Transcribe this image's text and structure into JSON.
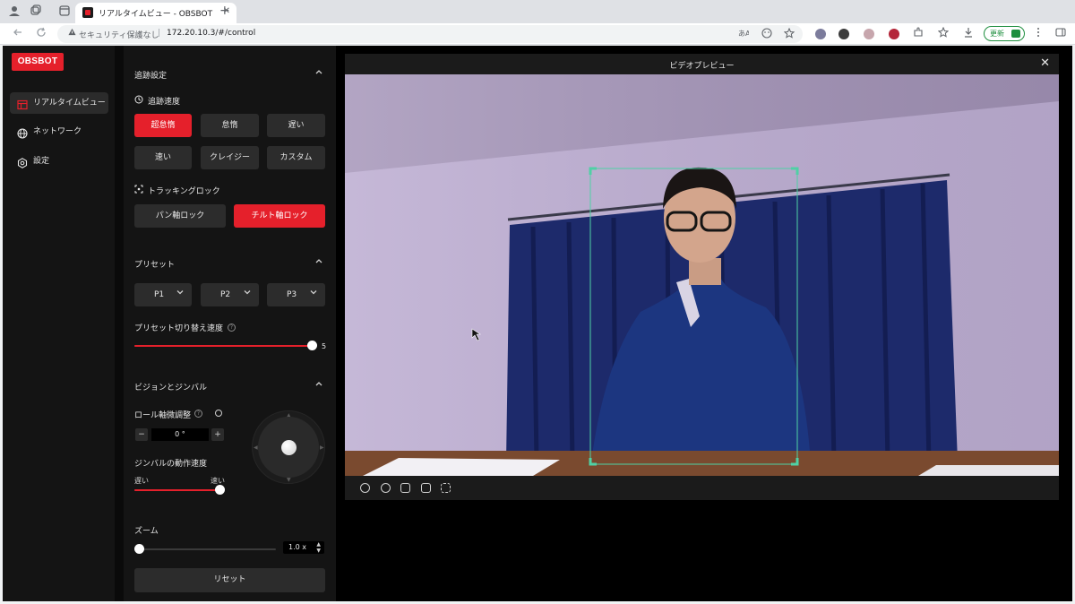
{
  "browser": {
    "tab_title": "リアルタイムビュー - OBSBOT",
    "tab_close": "✕",
    "new_tab": "+",
    "security_text": "セキュリティ保護なし",
    "separator": "|",
    "url": "172.20.10.3/#/control",
    "update_label": "更新"
  },
  "app": {
    "logo": "OBSBOT",
    "nav": [
      {
        "label": "リアルタイムビュー",
        "icon": "layout-icon",
        "active": true
      },
      {
        "label": "ネットワーク",
        "icon": "globe-icon",
        "active": false
      },
      {
        "label": "設定",
        "icon": "gear-icon",
        "active": false
      }
    ]
  },
  "tracking": {
    "title": "追跡設定",
    "speed_label": "追跡速度",
    "speeds": [
      "超怠惰",
      "怠惰",
      "遅い",
      "速い",
      "クレイジー",
      "カスタム"
    ],
    "selected_speed": "超怠惰",
    "lock_label": "トラッキングロック",
    "locks": [
      "パン軸ロック",
      "チルト軸ロック"
    ],
    "selected_lock": "チルト軸ロック"
  },
  "presets": {
    "title": "プリセット",
    "items": [
      "P1",
      "P2",
      "P3"
    ],
    "switch_speed_label": "プリセット切り替え速度",
    "switch_speed_value": "5",
    "switch_speed_fraction": 1.0
  },
  "gimbal": {
    "title": "ビジョンとジンバル",
    "roll_label": "ロール軸微調整",
    "roll_value": "0 °",
    "minus": "−",
    "plus": "+",
    "motion_speed_label": "ジンバルの動作速度",
    "slow_label": "遅い",
    "fast_label": "速い",
    "motion_speed_fraction": 1.0
  },
  "zoom": {
    "title": "ズーム",
    "value": "1.0 x",
    "fraction": 0.0
  },
  "reset_label": "リセット",
  "preview": {
    "title": "ビデオプレビュー",
    "close": "✕"
  },
  "colors": {
    "accent": "#e5202b",
    "panel": "#141414",
    "tracking_box": "#4fd1a5"
  }
}
